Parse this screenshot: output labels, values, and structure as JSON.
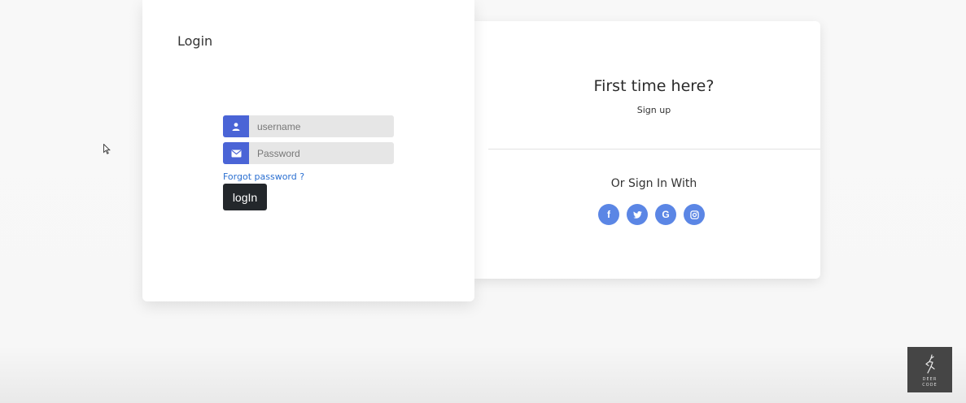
{
  "login": {
    "title": "Login",
    "username_placeholder": "username",
    "password_placeholder": "Password",
    "forgot_password": "Forgot password ?",
    "login_button": "logIn"
  },
  "signup": {
    "heading": "First time here?",
    "link": "Sign up",
    "or_sign_in": "Or Sign In With",
    "social": [
      {
        "icon": "facebook-icon",
        "glyph": "f"
      },
      {
        "icon": "twitter-icon",
        "glyph": "t"
      },
      {
        "icon": "google-icon",
        "glyph": "G"
      },
      {
        "icon": "instagram-icon",
        "glyph": "◎"
      }
    ]
  },
  "watermark": {
    "brand": "DEER CODE"
  },
  "colors": {
    "input_icon_bg": "#4a64d6",
    "social_bg": "#5b86e5",
    "button_bg": "#23272b",
    "link": "#2a6fd1"
  }
}
